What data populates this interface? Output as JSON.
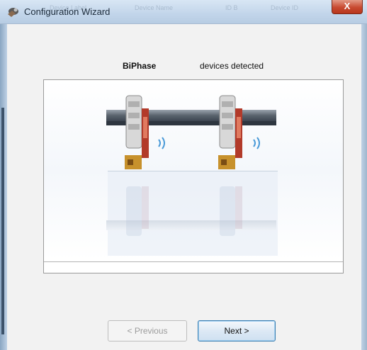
{
  "window": {
    "title": "Configuration Wizard",
    "close_label": "X",
    "background_text": [
      "Device Label",
      "Device Name",
      "ID B",
      "Device ID"
    ]
  },
  "main": {
    "brand": "BiPhase",
    "status_text": "devices detected",
    "image": {
      "description_icon": "stimulator-devices-illustration",
      "device_count": 2
    }
  },
  "buttons": {
    "previous_label": "< Previous",
    "previous_enabled": false,
    "next_label": "Next >"
  },
  "colors": {
    "accent": "#3c7fb1",
    "close": "#c84a31",
    "disabled_text": "#9c9c9c"
  }
}
